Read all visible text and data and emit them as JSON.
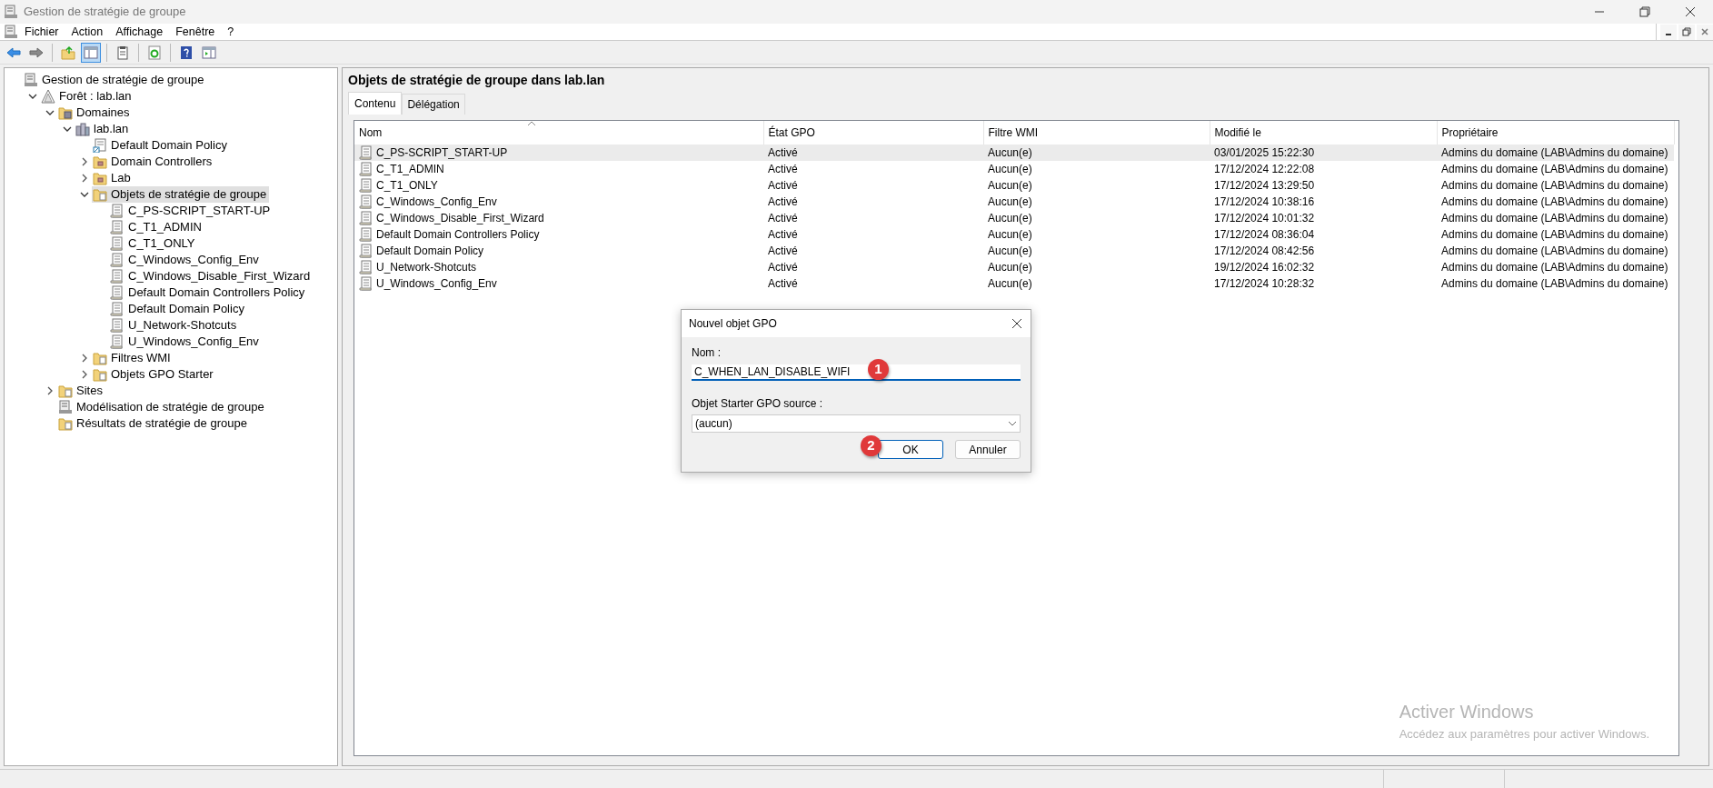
{
  "window": {
    "title": "Gestion de stratégie de groupe"
  },
  "menu": [
    "Fichier",
    "Action",
    "Affichage",
    "Fenêtre",
    "?"
  ],
  "toolbar": [
    {
      "kind": "back",
      "pressed": false
    },
    {
      "kind": "forward",
      "pressed": false
    },
    {
      "kind": "sep"
    },
    {
      "kind": "up",
      "pressed": false
    },
    {
      "kind": "tree",
      "pressed": true
    },
    {
      "kind": "sep"
    },
    {
      "kind": "clipboard",
      "pressed": false
    },
    {
      "kind": "sep"
    },
    {
      "kind": "refresh",
      "pressed": false
    },
    {
      "kind": "sep"
    },
    {
      "kind": "help",
      "pressed": false
    },
    {
      "kind": "pane",
      "pressed": false
    }
  ],
  "tree": [
    {
      "label": "Gestion de stratégie de groupe",
      "kind": "console",
      "selected": false,
      "children": [
        {
          "label": "Forêt : lab.lan",
          "kind": "forest",
          "expanded": true,
          "selected": false,
          "children": [
            {
              "label": "Domaines",
              "kind": "domains",
              "expanded": true,
              "selected": false,
              "children": [
                {
                  "label": "lab.lan",
                  "kind": "domain",
                  "expanded": true,
                  "selected": false,
                  "children": [
                    {
                      "label": "Default Domain Policy",
                      "kind": "link",
                      "selected": false
                    },
                    {
                      "label": "Domain Controllers",
                      "kind": "ou",
                      "expanded": false,
                      "selected": false
                    },
                    {
                      "label": "Lab",
                      "kind": "ou",
                      "expanded": false,
                      "selected": false
                    },
                    {
                      "label": "Objets de stratégie de groupe",
                      "kind": "folder",
                      "expanded": true,
                      "selected": true,
                      "children": [
                        {
                          "label": "C_PS-SCRIPT_START-UP",
                          "kind": "gpo",
                          "selected": false
                        },
                        {
                          "label": "C_T1_ADMIN",
                          "kind": "gpo",
                          "selected": false
                        },
                        {
                          "label": "C_T1_ONLY",
                          "kind": "gpo",
                          "selected": false
                        },
                        {
                          "label": "C_Windows_Config_Env",
                          "kind": "gpo",
                          "selected": false
                        },
                        {
                          "label": "C_Windows_Disable_First_Wizard",
                          "kind": "gpo",
                          "selected": false
                        },
                        {
                          "label": "Default Domain Controllers Policy",
                          "kind": "gpo",
                          "selected": false
                        },
                        {
                          "label": "Default Domain Policy",
                          "kind": "gpo",
                          "selected": false
                        },
                        {
                          "label": "U_Network-Shotcuts",
                          "kind": "gpo",
                          "selected": false
                        },
                        {
                          "label": "U_Windows_Config_Env",
                          "kind": "gpo",
                          "selected": false
                        }
                      ]
                    },
                    {
                      "label": "Filtres WMI",
                      "kind": "folder",
                      "expanded": false,
                      "selected": false
                    },
                    {
                      "label": "Objets GPO Starter",
                      "kind": "folder",
                      "expanded": false,
                      "selected": false
                    }
                  ]
                }
              ]
            },
            {
              "label": "Sites",
              "kind": "folder",
              "expanded": false,
              "selected": false
            },
            {
              "label": "Modélisation de stratégie de groupe",
              "kind": "console",
              "selected": false
            },
            {
              "label": "Résultats de stratégie de groupe",
              "kind": "folder",
              "selected": false
            }
          ]
        }
      ]
    }
  ],
  "panel": {
    "title": "Objets de stratégie de groupe dans lab.lan",
    "tabs": [
      {
        "label": "Contenu",
        "selected": true
      },
      {
        "label": "Délégation",
        "selected": false
      }
    ],
    "table": {
      "columns": [
        "Nom",
        "État GPO",
        "Filtre WMI",
        "Modifié le",
        "Propriétaire"
      ],
      "rows": [
        {
          "selected": true,
          "cells": [
            "C_PS-SCRIPT_START-UP",
            "Activé",
            "Aucun(e)",
            "03/01/2025 15:22:30",
            "Admins du domaine (LAB\\Admins du domaine)"
          ]
        },
        {
          "selected": false,
          "cells": [
            "C_T1_ADMIN",
            "Activé",
            "Aucun(e)",
            "17/12/2024 12:22:08",
            "Admins du domaine (LAB\\Admins du domaine)"
          ]
        },
        {
          "selected": false,
          "cells": [
            "C_T1_ONLY",
            "Activé",
            "Aucun(e)",
            "17/12/2024 13:29:50",
            "Admins du domaine (LAB\\Admins du domaine)"
          ]
        },
        {
          "selected": false,
          "cells": [
            "C_Windows_Config_Env",
            "Activé",
            "Aucun(e)",
            "17/12/2024 10:38:16",
            "Admins du domaine (LAB\\Admins du domaine)"
          ]
        },
        {
          "selected": false,
          "cells": [
            "C_Windows_Disable_First_Wizard",
            "Activé",
            "Aucun(e)",
            "17/12/2024 10:01:32",
            "Admins du domaine (LAB\\Admins du domaine)"
          ]
        },
        {
          "selected": false,
          "cells": [
            "Default Domain Controllers Policy",
            "Activé",
            "Aucun(e)",
            "17/12/2024 08:36:04",
            "Admins du domaine (LAB\\Admins du domaine)"
          ]
        },
        {
          "selected": false,
          "cells": [
            "Default Domain Policy",
            "Activé",
            "Aucun(e)",
            "17/12/2024 08:42:56",
            "Admins du domaine (LAB\\Admins du domaine)"
          ]
        },
        {
          "selected": false,
          "cells": [
            "U_Network-Shotcuts",
            "Activé",
            "Aucun(e)",
            "19/12/2024 16:02:32",
            "Admins du domaine (LAB\\Admins du domaine)"
          ]
        },
        {
          "selected": false,
          "cells": [
            "U_Windows_Config_Env",
            "Activé",
            "Aucun(e)",
            "17/12/2024 10:28:32",
            "Admins du domaine (LAB\\Admins du domaine)"
          ]
        }
      ]
    }
  },
  "dialog": {
    "title": "Nouvel objet GPO",
    "name_label": "Nom :",
    "name_value": "C_WHEN_LAN_DISABLE_WIFI",
    "source_label": "Objet Starter GPO source :",
    "source_value": "(aucun)",
    "ok": "OK",
    "cancel": "Annuler",
    "markers": [
      "1",
      "2"
    ]
  },
  "activation": {
    "title": "Activer Windows",
    "text": "Accédez aux paramètres pour activer Windows."
  }
}
